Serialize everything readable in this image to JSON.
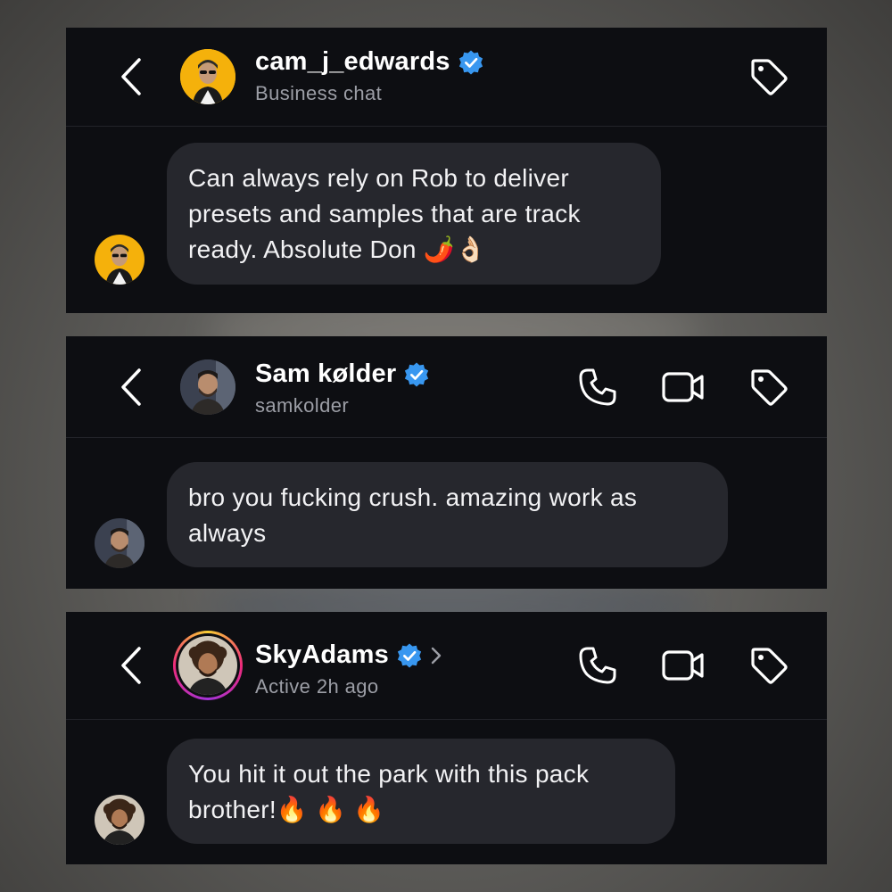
{
  "chats": [
    {
      "header": {
        "name": "cam_j_edwards",
        "subtitle": "Business chat",
        "avatar_icon": "avatar-photo-sunglasses",
        "verified_icon": "verified-badge-icon"
      },
      "message": {
        "text": "Can always rely on Rob to deliver presets and samples that are track ready. Absolute Don 🌶️👌🏻"
      }
    },
    {
      "header": {
        "name": "Sam kølder",
        "subtitle": "samkolder",
        "avatar_icon": "avatar-photo-beard",
        "verified_icon": "verified-badge-icon"
      },
      "message": {
        "text": "bro you fucking crush. amazing work as always"
      }
    },
    {
      "header": {
        "name": "SkyAdams",
        "subtitle": "Active 2h ago",
        "avatar_icon": "avatar-photo-curly-hair",
        "verified_icon": "verified-badge-icon",
        "story_ring": true
      },
      "message": {
        "text": "You hit it out the park with this pack brother!🔥 🔥 🔥"
      }
    }
  ],
  "colors": {
    "verified": "#3897f0",
    "card_bg": "#0d0e12",
    "bubble_bg": "#26272d",
    "subtitle": "#9c9ea6"
  }
}
